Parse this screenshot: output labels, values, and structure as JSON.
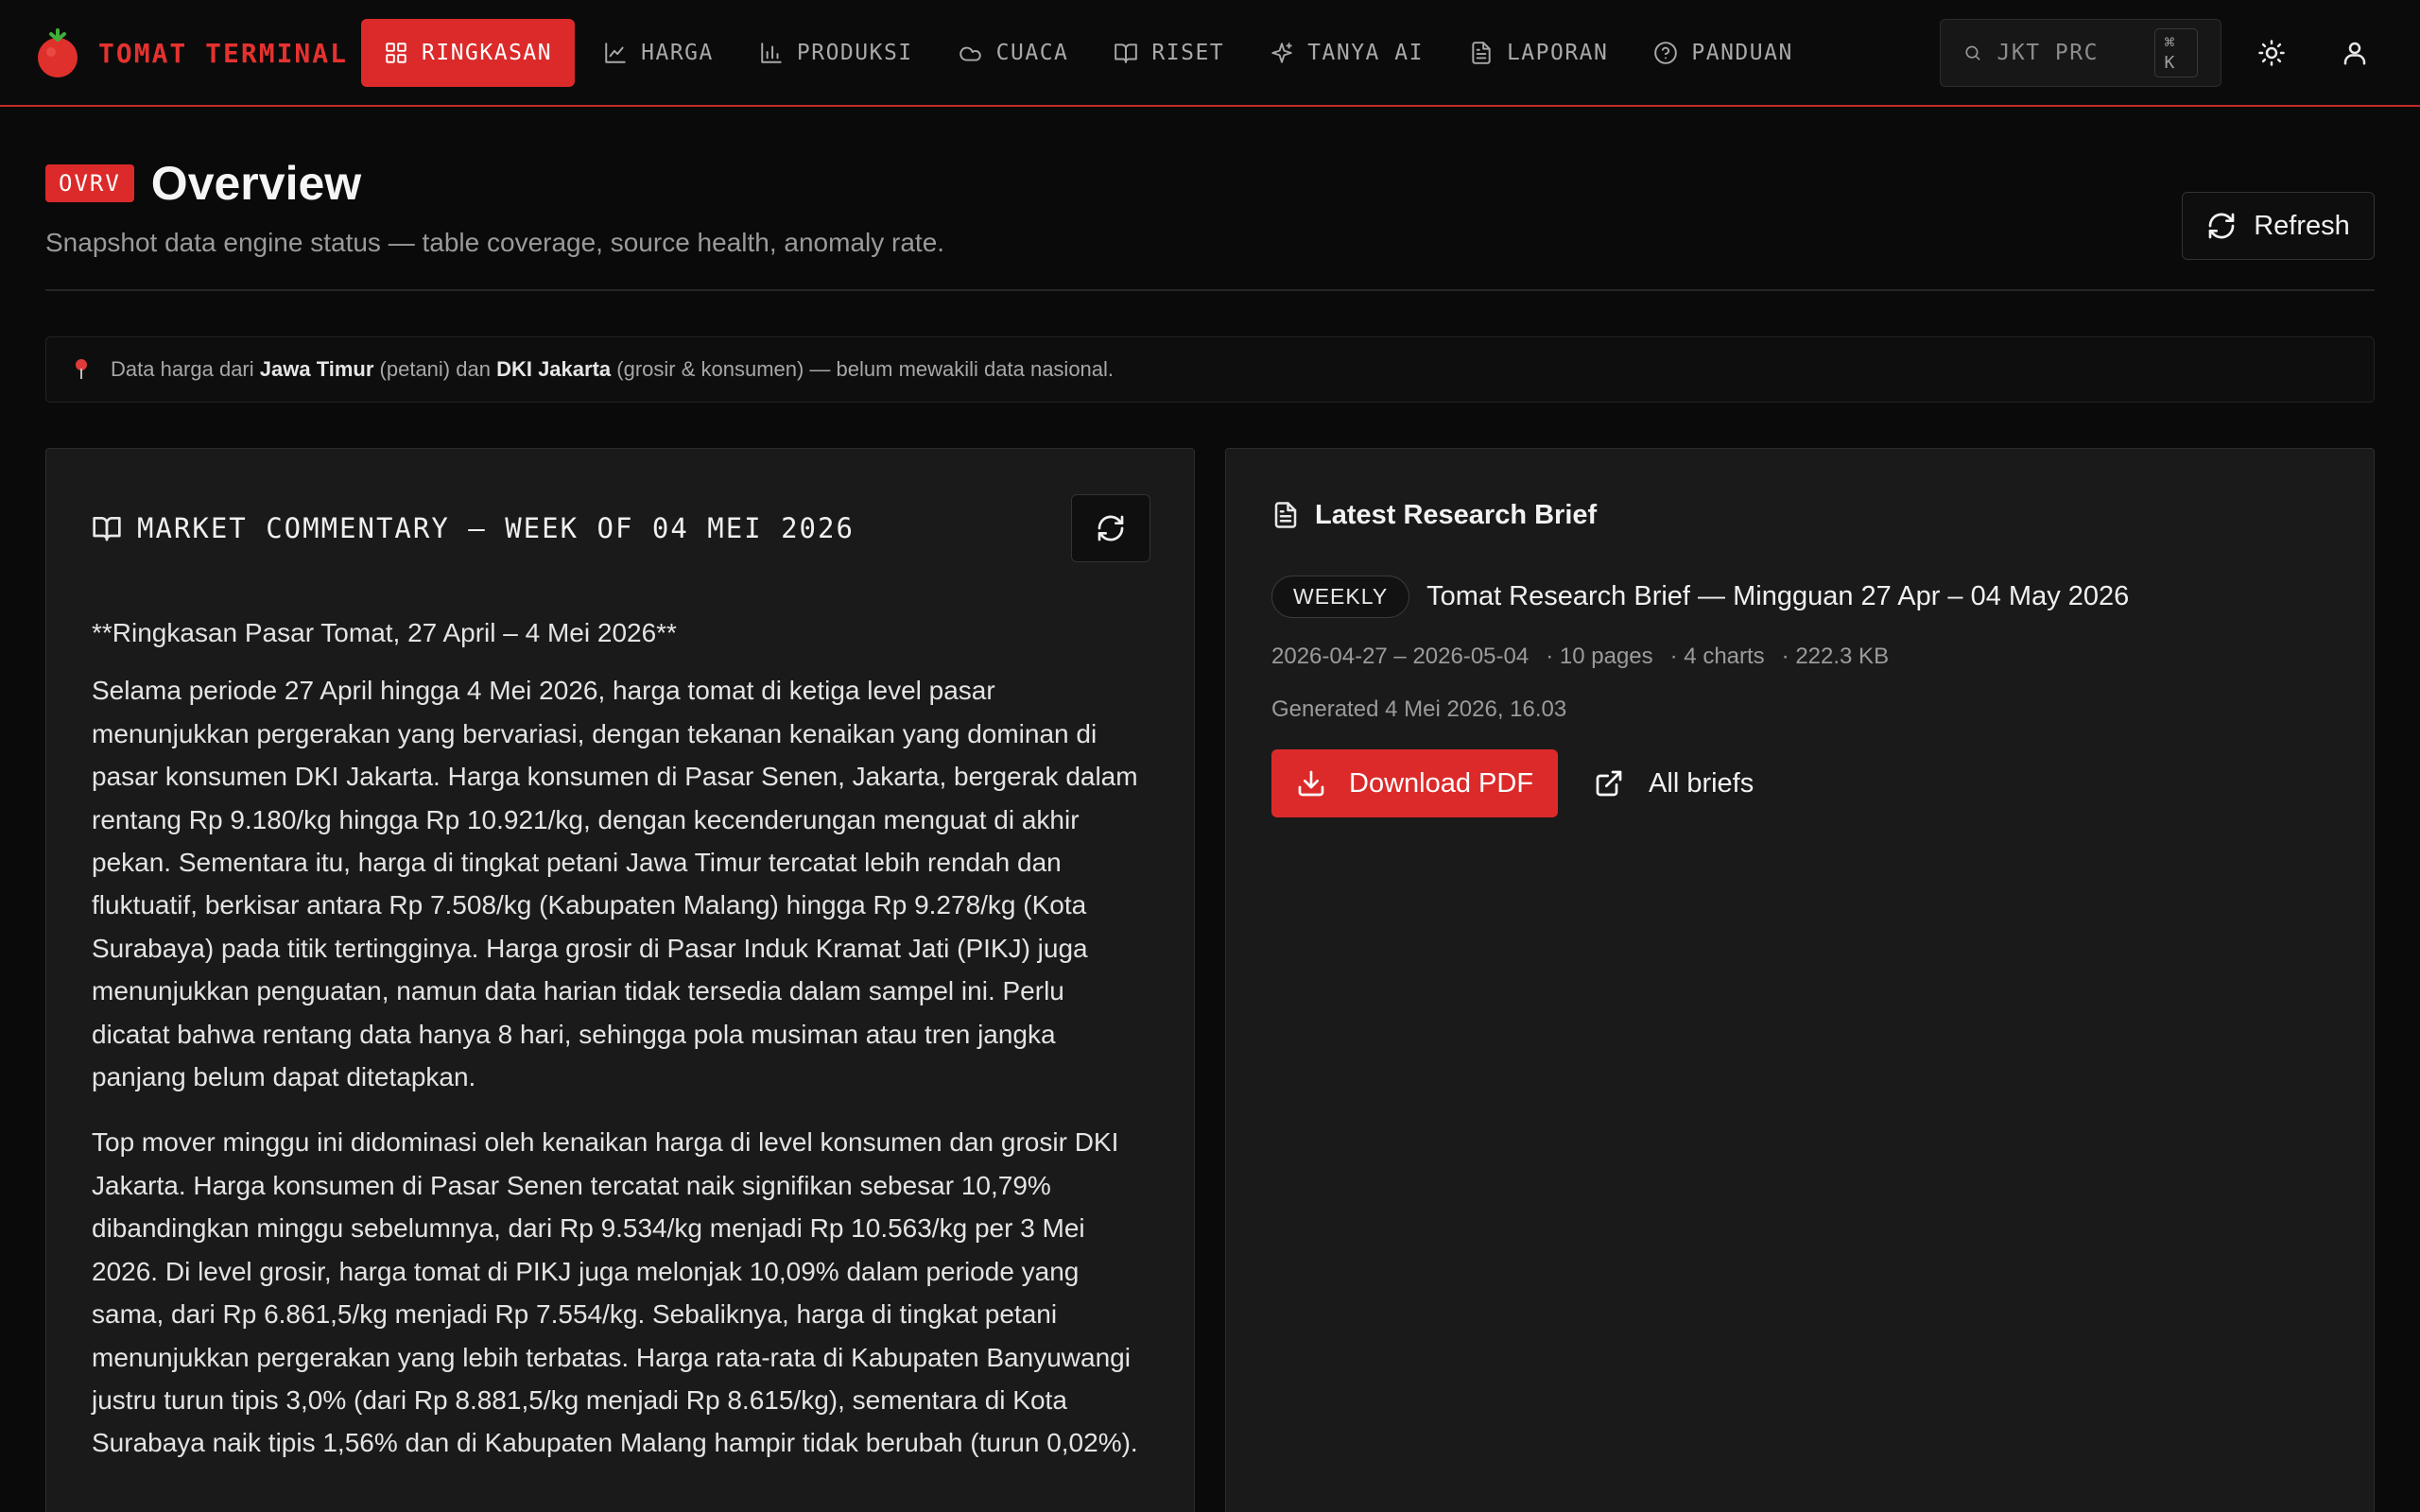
{
  "brand": {
    "name": "TOMAT TERMINAL",
    "logo_icon": "tomato-icon",
    "accent": "#dc2a2a"
  },
  "nav": {
    "items": [
      {
        "label": "RINGKASAN",
        "icon": "grid-icon",
        "active": true
      },
      {
        "label": "HARGA",
        "icon": "line-chart-icon"
      },
      {
        "label": "PRODUKSI",
        "icon": "bar-chart-icon"
      },
      {
        "label": "CUACA",
        "icon": "cloud-icon"
      },
      {
        "label": "RISET",
        "icon": "book-icon"
      },
      {
        "label": "TANYA AI",
        "icon": "sparkle-icon"
      },
      {
        "label": "LAPORAN",
        "icon": "document-icon"
      },
      {
        "label": "PANDUAN",
        "icon": "help-icon"
      }
    ]
  },
  "search": {
    "placeholder": "JKT PRC",
    "shortcut": "⌘ K"
  },
  "header": {
    "code": "OVRV",
    "title": "Overview",
    "subtitle": "Snapshot data engine status — table coverage, source health, anomaly rate.",
    "refresh_label": "Refresh"
  },
  "notice": {
    "prefix": "Data harga dari ",
    "region1": "Jawa Timur",
    "mid1": " (petani) dan ",
    "region2": "DKI Jakarta",
    "suffix": " (grosir & konsumen) — belum mewakili data nasional."
  },
  "commentary": {
    "title": "MARKET COMMENTARY — WEEK OF 04 MEI 2026",
    "heading": "**Ringkasan Pasar Tomat, 27 April – 4 Mei 2026**",
    "paragraphs": [
      "Selama periode 27 April hingga 4 Mei 2026, harga tomat di ketiga level pasar menunjukkan pergerakan yang bervariasi, dengan tekanan kenaikan yang dominan di pasar konsumen DKI Jakarta. Harga konsumen di Pasar Senen, Jakarta, bergerak dalam rentang Rp 9.180/kg hingga Rp 10.921/kg, dengan kecenderungan menguat di akhir pekan. Sementara itu, harga di tingkat petani Jawa Timur tercatat lebih rendah dan fluktuatif, berkisar antara Rp 7.508/kg (Kabupaten Malang) hingga Rp 9.278/kg (Kota Surabaya) pada titik tertingginya. Harga grosir di Pasar Induk Kramat Jati (PIKJ) juga menunjukkan penguatan, namun data harian tidak tersedia dalam sampel ini. Perlu dicatat bahwa rentang data hanya 8 hari, sehingga pola musiman atau tren jangka panjang belum dapat ditetapkan.",
      "Top mover minggu ini didominasi oleh kenaikan harga di level konsumen dan grosir DKI Jakarta. Harga konsumen di Pasar Senen tercatat naik signifikan sebesar 10,79% dibandingkan minggu sebelumnya, dari Rp 9.534/kg menjadi Rp 10.563/kg per 3 Mei 2026. Di level grosir, harga tomat di PIKJ juga melonjak 10,09% dalam periode yang sama, dari Rp 6.861,5/kg menjadi Rp 7.554/kg. Sebaliknya, harga di tingkat petani menunjukkan pergerakan yang lebih terbatas. Harga rata-rata di Kabupaten Banyuwangi justru turun tipis 3,0% (dari Rp 8.881,5/kg menjadi Rp 8.615/kg), sementara di Kota Surabaya naik tipis 1,56% dan di Kabupaten Malang hampir tidak berubah (turun 0,02%)."
    ]
  },
  "brief": {
    "section_title": "Latest Research Brief",
    "tag": "WEEKLY",
    "title": "Tomat Research Brief — Mingguan 27 Apr – 04 May 2026",
    "meta": [
      "2026-04-27 – 2026-05-04",
      "· 10 pages",
      "· 4 charts",
      "· 222.3 KB"
    ],
    "generated": "Generated 4 Mei 2026, 16.03",
    "download_label": "Download PDF",
    "all_label": "All briefs"
  }
}
